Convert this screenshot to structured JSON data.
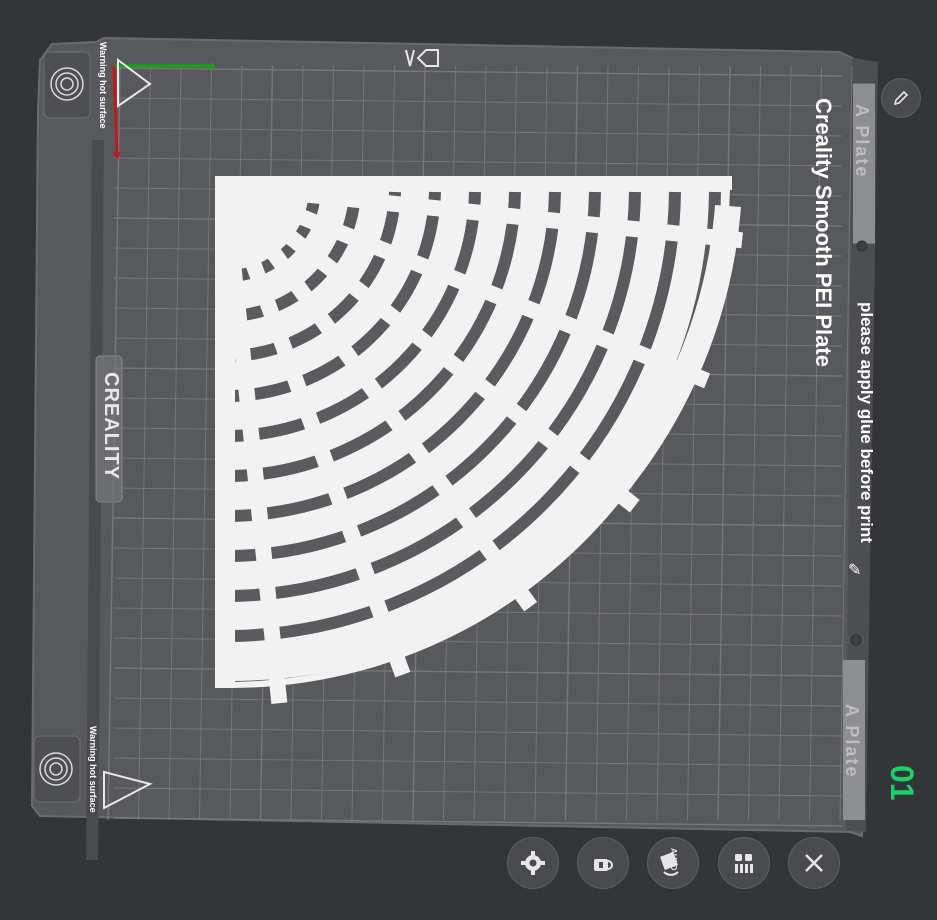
{
  "plate": {
    "name_label": "A Plate",
    "name_label_bottom": "A Plate",
    "type_title": "Creality Smooth PEI Plate",
    "note": "please apply glue before print",
    "warning_top": "Warning hot surface",
    "warning_bottom": "Warning hot surface",
    "brand": "CREALITY",
    "number": "01"
  },
  "colors": {
    "background": "#343538",
    "plate": "#58595d",
    "grid": "#76777b",
    "model": "#f2f2f2",
    "axis_x": "#16a316",
    "axis_y": "#c0181c",
    "plate_number": "#19d36a"
  },
  "icons": {
    "edit": "pencil-icon",
    "home": "home-arrow-icon",
    "toolbar": [
      "gear-icon",
      "lock-icon",
      "auto-arrange-icon",
      "layout-icon",
      "close-icon"
    ],
    "auto_label": "AUTO"
  }
}
